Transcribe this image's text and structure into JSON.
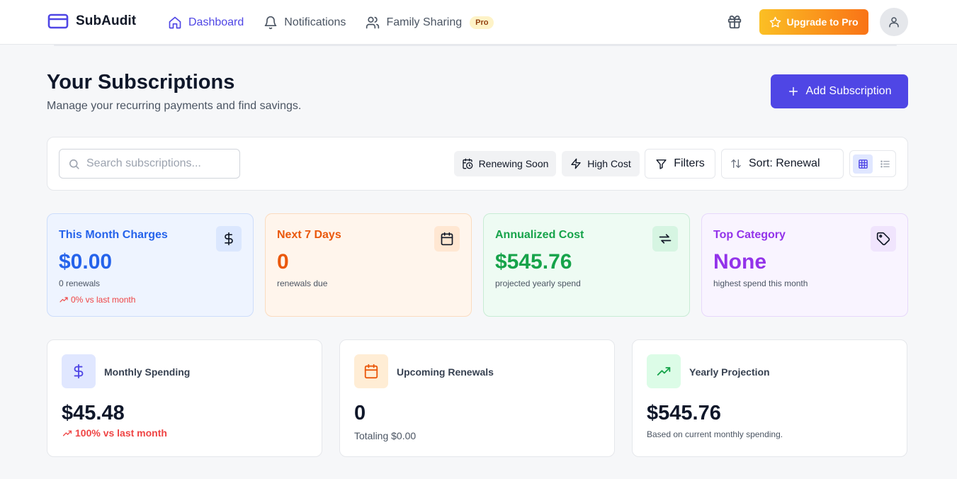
{
  "nav": {
    "brand": "SubAudit",
    "links": [
      {
        "label": "Dashboard",
        "icon": "home-icon",
        "active": true
      },
      {
        "label": "Notifications",
        "icon": "bell-icon",
        "active": false
      },
      {
        "label": "Family Sharing",
        "icon": "users-icon",
        "active": false,
        "badge": "Pro"
      }
    ],
    "gift_icon": "gift-icon",
    "upgrade_label": "Upgrade to Pro",
    "avatar_icon": "user-icon",
    "accent_color": "#4f46e5"
  },
  "header": {
    "title": "Your Subscriptions",
    "subtitle": "Manage your recurring payments and find savings.",
    "add_button": "Add Subscription"
  },
  "toolbar": {
    "search_placeholder": "Search subscriptions...",
    "search_value": "",
    "chip_renewing": "Renewing Soon",
    "chip_high_cost": "High Cost",
    "filters": "Filters",
    "sort": "Sort: Renewal",
    "view_mode": "grid"
  },
  "stats": [
    {
      "label": "This Month Charges",
      "value": "$0.00",
      "sub": "0 renewals",
      "trend": "0% vs last month",
      "icon": "dollar-icon",
      "color": "#2563eb"
    },
    {
      "label": "Next 7 Days",
      "value": "0",
      "sub": "renewals due",
      "icon": "calendar-icon",
      "color": "#ea580c"
    },
    {
      "label": "Annualized Cost",
      "value": "$545.76",
      "sub": "projected yearly spend",
      "icon": "repeat-icon",
      "color": "#16a34a"
    },
    {
      "label": "Top Category",
      "value": "None",
      "sub": "highest spend this month",
      "icon": "tag-icon",
      "color": "#9333ea"
    }
  ],
  "summary": [
    {
      "title": "Monthly Spending",
      "amount": "$45.48",
      "note": "100% vs last month",
      "icon": "dollar-icon"
    },
    {
      "title": "Upcoming Renewals",
      "amount": "0",
      "note": "Totaling $0.00",
      "icon": "calendar-icon"
    },
    {
      "title": "Yearly Projection",
      "amount": "$545.76",
      "note": "Based on current monthly spending.",
      "icon": "trending-up-icon"
    }
  ]
}
